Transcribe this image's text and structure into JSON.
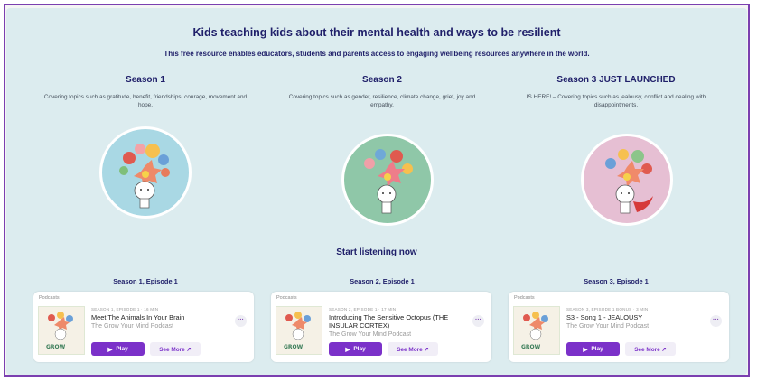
{
  "header": {
    "headline": "Kids teaching kids about their mental health and ways to be resilient",
    "subline": "This free resource enables educators, students and parents access to engaging wellbeing resources anywhere in the world."
  },
  "seasons": [
    {
      "title": "Season 1",
      "description": "Covering topics such as gratitude, benefit, friendships, courage, movement and hope.",
      "circle_color": "#a9d8e4"
    },
    {
      "title": "Season 2",
      "description": "Covering topics such as gender, resilience, climate change, grief, joy and empathy.",
      "circle_color": "#8fc7a8"
    },
    {
      "title": "Season 3 JUST LAUNCHED",
      "description": "IS HERE! – Covering topics such as jealousy, conflict and dealing with disappointments.",
      "circle_color": "#e6bfd3"
    }
  ],
  "listen_heading": "Start listening now",
  "episodes": [
    {
      "heading": "Season 1, Episode 1",
      "source": "Podcasts",
      "meta": "SEASON 1, EPISODE 1 · 16 MIN",
      "title": "Meet The Animals In Your Brain",
      "show": "The Grow Your Mind Podcast",
      "play": "Play",
      "see_more": "See More ↗"
    },
    {
      "heading": "Season 2, Episode 1",
      "source": "Podcasts",
      "meta": "SEASON 2, EPISODE 1 · 17 MIN",
      "title": "Introducing The Sensitive Octopus (THE INSULAR CORTEX)",
      "show": "The Grow Your Mind Podcast",
      "play": "Play",
      "see_more": "See More ↗"
    },
    {
      "heading": "Season 3, Episode 1",
      "source": "Podcasts",
      "meta": "SEASON 3, EPISODE 1 BONUS · 3 MIN",
      "title": "S3 - Song 1 - JEALOUSY",
      "show": "The Grow Your Mind Podcast",
      "play": "Play",
      "see_more": "See More ↗"
    }
  ],
  "colors": {
    "frame": "#7b3fb0",
    "panel": "#dcecef",
    "heading": "#20206a",
    "play_button": "#7b31c9"
  }
}
